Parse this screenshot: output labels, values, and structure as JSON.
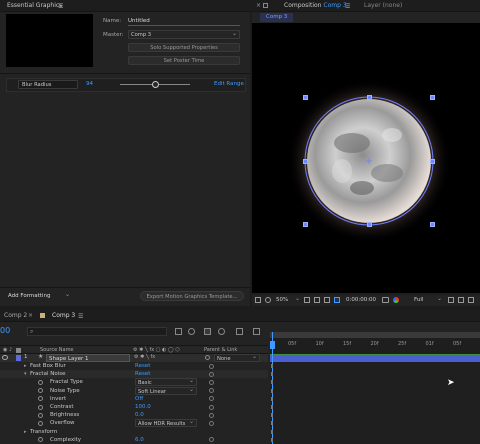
{
  "essential_graphics": {
    "tab_label": "Essential Graphics",
    "name_label": "Name:",
    "name_value": "Untitled",
    "master_label": "Master:",
    "master_value": "Comp 3",
    "solo_button": "Solo Supported Properties",
    "poster_button": "Set Poster Time",
    "property_name": "Blur Radius",
    "property_value": "94",
    "slider_fraction": 0.5,
    "edit_range": "Edit Range",
    "add_formatting": "Add Formatting",
    "export_button": "Export Motion Graphics Template..."
  },
  "composition": {
    "tab_label": "Composition",
    "comp_name": "Comp 3",
    "layer_tab": "Layer (none)",
    "inner_tab": "Comp 3",
    "toolbar": {
      "zoom": "50%",
      "timecode": "0:00:00:00",
      "quality": "Full"
    }
  },
  "timeline": {
    "tabs": [
      "Comp 2",
      "Comp 3"
    ],
    "current_time": "00",
    "header": {
      "source_name": "Source Name",
      "parent_link": "Parent & Link"
    },
    "ruler_ticks": [
      "05f",
      "10f",
      "15f",
      "20f",
      "25f",
      "01f",
      "05f"
    ],
    "layer": {
      "name": "Shape Layer 1",
      "parent": "None"
    },
    "rows": [
      {
        "indent": 1,
        "name": "Fast Box Blur",
        "value": "Reset",
        "kind": "reset"
      },
      {
        "indent": 1,
        "name": "Fractal Noise",
        "value": "Reset",
        "kind": "reset"
      },
      {
        "indent": 2,
        "name": "Fractal Type",
        "value": "Basic",
        "kind": "dropdown"
      },
      {
        "indent": 2,
        "name": "Noise Type",
        "value": "Soft Linear",
        "kind": "dropdown"
      },
      {
        "indent": 2,
        "name": "Invert",
        "value": "Off",
        "kind": "value"
      },
      {
        "indent": 2,
        "name": "Contrast",
        "value": "100.0",
        "kind": "value"
      },
      {
        "indent": 2,
        "name": "Brightness",
        "value": "0.0",
        "kind": "value"
      },
      {
        "indent": 2,
        "name": "Overflow",
        "value": "Allow HDR Results",
        "kind": "dropdown"
      },
      {
        "indent": 1,
        "name": "Transform",
        "value": "",
        "kind": "group"
      },
      {
        "indent": 2,
        "name": "Complexity",
        "value": "6.0",
        "kind": "value"
      }
    ]
  },
  "colors": {
    "accent": "#3f9bff",
    "layer_label": "#5b6bd8",
    "track_green": "#3c8f3c",
    "track_blue": "#4b5fd1"
  }
}
